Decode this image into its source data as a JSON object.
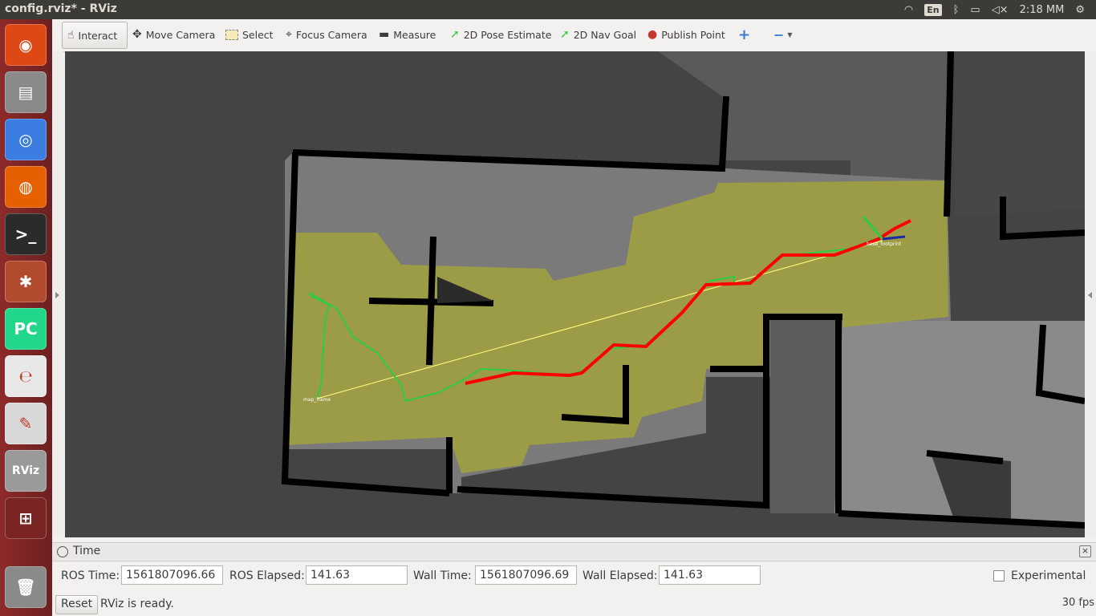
{
  "window": {
    "title": "config.rviz* - RViz"
  },
  "tray": {
    "lang": "En",
    "clock": "2:18 MM"
  },
  "launcher": [
    {
      "name": "ubuntu-dash",
      "glyph": "◉",
      "bg": "#dd4814"
    },
    {
      "name": "files",
      "glyph": "▤",
      "bg": "#8a8a8a"
    },
    {
      "name": "chrome",
      "glyph": "◎",
      "bg": "#3b7de0"
    },
    {
      "name": "firefox",
      "glyph": "◍",
      "bg": "#e66000"
    },
    {
      "name": "terminal",
      "glyph": ">_",
      "bg": "#2b2b2b"
    },
    {
      "name": "system-settings",
      "glyph": "✱",
      "bg": "#b24a2e"
    },
    {
      "name": "pycharm",
      "glyph": "PC",
      "bg": "#21d789"
    },
    {
      "name": "document-viewer",
      "glyph": "℮",
      "bg": "#e8e8e8"
    },
    {
      "name": "text-editor",
      "glyph": "✎",
      "bg": "#d8d8d8"
    },
    {
      "name": "rviz",
      "glyph": "RViz",
      "bg": "#9a9a9a"
    },
    {
      "name": "workspaces",
      "glyph": "⊞",
      "bg": "#7a2424"
    }
  ],
  "toolbar": {
    "interact": "Interact",
    "move_camera": "Move Camera",
    "select": "Select",
    "focus_camera": "Focus Camera",
    "measure": "Measure",
    "pose_estimate": "2D Pose Estimate",
    "nav_goal": "2D Nav Goal",
    "publish_point": "Publish Point"
  },
  "viewport": {
    "start_label": "map_frame",
    "robot_label": "base_footprint"
  },
  "time_panel": {
    "title": "Time",
    "ros_time_label": "ROS Time:",
    "ros_time": "1561807096.66",
    "ros_elapsed_label": "ROS Elapsed:",
    "ros_elapsed": "141.63",
    "wall_time_label": "Wall Time:",
    "wall_time": "1561807096.69",
    "wall_elapsed_label": "Wall Elapsed:",
    "wall_elapsed": "141.63",
    "experimental_label": "Experimental"
  },
  "status": {
    "reset": "Reset",
    "message": "RViz is ready.",
    "fps": "30 fps"
  },
  "colors": {
    "costmap": "#a0a040",
    "plan": "#ff0000",
    "trajectory": "#2ecc40",
    "wall": "#000000"
  }
}
